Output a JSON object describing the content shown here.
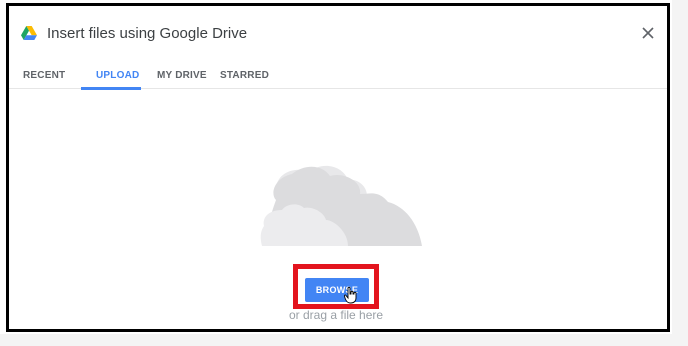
{
  "dialog": {
    "title": "Insert files using Google Drive",
    "close_icon": "close-icon",
    "logo_icon": "google-drive-icon"
  },
  "tabs": [
    {
      "label": "RECENT",
      "active": false
    },
    {
      "label": "UPLOAD",
      "active": true
    },
    {
      "label": "MY DRIVE",
      "active": false
    },
    {
      "label": "STARRED",
      "active": false
    }
  ],
  "upload": {
    "illustration_icon": "cloud-icon",
    "browse_label": "BROWSE",
    "drag_text": "or drag a file here",
    "cursor_icon": "hand-pointer-icon"
  },
  "colors": {
    "accent": "#4285f4",
    "highlight": "#e3141e"
  }
}
